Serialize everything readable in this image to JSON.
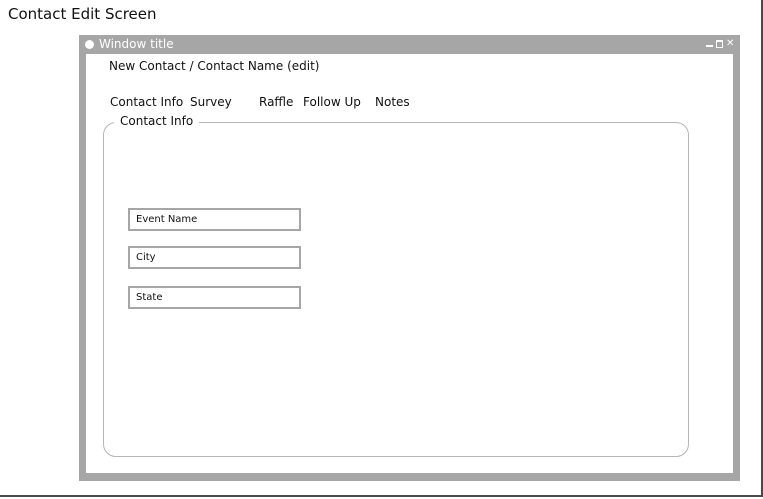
{
  "screen": {
    "title": "Contact Edit Screen"
  },
  "window": {
    "title": "Window title",
    "controls": {
      "minimize_icon": "minimize-icon",
      "maximize_icon": "maximize-icon",
      "close_glyph": "✕"
    }
  },
  "breadcrumb": "New Contact / Contact Name (edit)",
  "tabs": [
    {
      "label": "Contact Info"
    },
    {
      "label": "Survey"
    },
    {
      "label": "Raffle"
    },
    {
      "label": "Follow Up"
    },
    {
      "label": "Notes"
    }
  ],
  "contact_info": {
    "legend": "Contact Info",
    "fields": [
      {
        "placeholder": "Event Name",
        "value": ""
      },
      {
        "placeholder": "City",
        "value": ""
      },
      {
        "placeholder": "State",
        "value": ""
      }
    ]
  },
  "colors": {
    "window_chrome": "#a6a6a6",
    "group_border": "#b5b5b5",
    "field_border": "#a6a6a6",
    "page_border": "#4a4a4a"
  }
}
